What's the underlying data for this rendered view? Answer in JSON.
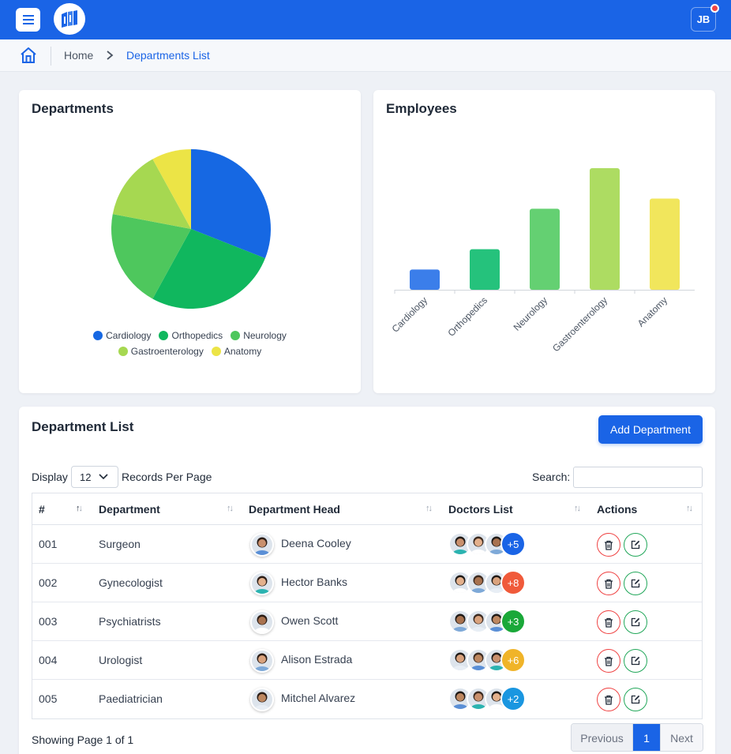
{
  "header": {
    "menu_icon": "hamburger-icon",
    "logo_icon": "hospital-logo",
    "user_initials": "JB",
    "brand_color": "#1a64e6"
  },
  "breadcrumb": {
    "home_icon": "home-icon",
    "home_label": "Home",
    "current_label": "Departments List"
  },
  "departments_card": {
    "title": "Departments"
  },
  "employees_card": {
    "title": "Employees"
  },
  "chart_data": [
    {
      "type": "pie",
      "title": "Departments",
      "categories": [
        "Cardiology",
        "Orthopedics",
        "Neurology",
        "Gastroenterology",
        "Anatomy"
      ],
      "values": [
        31,
        27,
        20,
        14,
        8
      ],
      "colors": [
        "#1668e3",
        "#10b75e",
        "#4ec75d",
        "#a6d851",
        "#ece446"
      ],
      "legend": "bottom"
    },
    {
      "type": "bar",
      "title": "Employees",
      "categories": [
        "Cardiology",
        "Orthopedics",
        "Neurology",
        "Gastroenterology",
        "Anatomy"
      ],
      "values": [
        10,
        20,
        40,
        60,
        45
      ],
      "colors": [
        "#3b7eea",
        "#25c27c",
        "#64d072",
        "#addc62",
        "#f1e65c"
      ],
      "ylim": [
        0,
        60
      ],
      "grid": false
    }
  ],
  "department_list": {
    "title": "Department List",
    "add_button": "Add Department",
    "display_label": "Display",
    "records_per_page": "12",
    "records_label": "Records Per Page",
    "search_label": "Search:",
    "search_value": "",
    "columns": [
      "#",
      "Department",
      "Department Head",
      "Doctors List",
      "Actions"
    ],
    "rows": [
      {
        "id": "001",
        "department": "Surgeon",
        "head": "Deena Cooley",
        "more": "+5",
        "more_color": "#1a64e6"
      },
      {
        "id": "002",
        "department": "Gynecologist",
        "head": "Hector Banks",
        "more": "+8",
        "more_color": "#f05a3a"
      },
      {
        "id": "003",
        "department": "Psychiatrists",
        "head": "Owen Scott",
        "more": "+3",
        "more_color": "#1aa839"
      },
      {
        "id": "004",
        "department": "Urologist",
        "head": "Alison Estrada",
        "more": "+6",
        "more_color": "#f0b429"
      },
      {
        "id": "005",
        "department": "Paediatrician",
        "head": "Mitchel Alvarez",
        "more": "+2",
        "more_color": "#1a96e0"
      }
    ],
    "delete_icon": "trash-icon",
    "edit_icon": "edit-icon",
    "showing": "Showing Page 1 of 1",
    "pagination": {
      "previous": "Previous",
      "current": "1",
      "next": "Next"
    }
  }
}
